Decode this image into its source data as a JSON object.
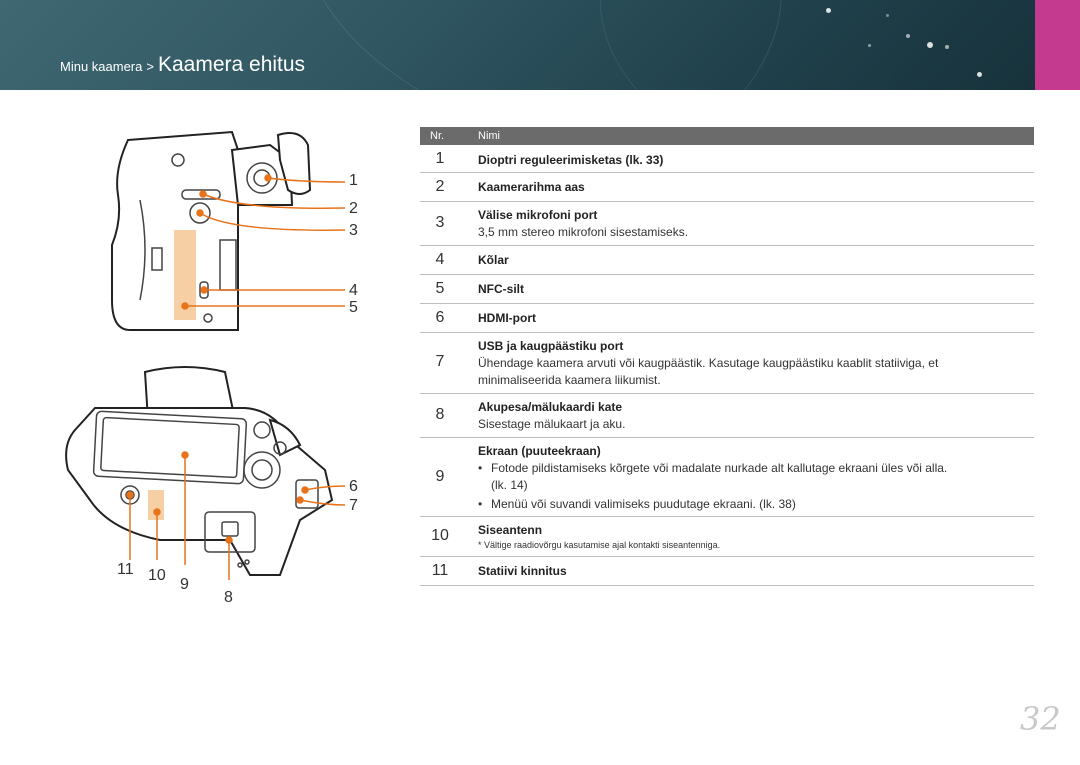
{
  "header": {
    "breadcrumb_parent": "Minu kaamera",
    "breadcrumb_separator": ">",
    "title": "Kaamera ehitus"
  },
  "table": {
    "col_nr": "Nr.",
    "col_name": "Nimi",
    "rows": [
      {
        "nr": "1",
        "name": "Dioptri reguleerimisketas (lk. 33)"
      },
      {
        "nr": "2",
        "name": "Kaamerarihma aas"
      },
      {
        "nr": "3",
        "name": "Välise mikrofoni port",
        "desc": "3,5 mm stereo mikrofoni sisestamiseks."
      },
      {
        "nr": "4",
        "name": "Kõlar"
      },
      {
        "nr": "5",
        "name": "NFC-silt"
      },
      {
        "nr": "6",
        "name": "HDMI-port"
      },
      {
        "nr": "7",
        "name": "USB ja kaugpäästiku port",
        "desc1": "Ühendage kaamera arvuti või kaugpäästik. Kasutage kaugpäästiku kaablit statiiviga, et",
        "desc2": "minimaliseerida kaamera liikumist."
      },
      {
        "nr": "8",
        "name": "Akupesa/mälukaardi kate",
        "desc": "Sisestage mälukaart ja aku."
      },
      {
        "nr": "9",
        "name": "Ekraan (puuteekraan)",
        "bullet1a": "Fotode pildistamiseks kõrgete või madalate nurkade alt kallutage ekraani üles või alla.",
        "bullet1b": "(lk. 14)",
        "bullet2": "Menüü või suvandi valimiseks puudutage ekraani. (lk. 38)"
      },
      {
        "nr": "10",
        "name": "Siseantenn",
        "note": "* Vältige raadiovõrgu kasutamise ajal kontakti siseantenniga."
      },
      {
        "nr": "11",
        "name": "Statiivi kinnitus"
      }
    ]
  },
  "callouts": {
    "c1": "1",
    "c2": "2",
    "c3": "3",
    "c4": "4",
    "c5": "5",
    "c6": "6",
    "c7": "7",
    "c8": "8",
    "c9": "9",
    "c10": "10",
    "c11": "11"
  },
  "bullet_char": "•",
  "page_number": "32",
  "colors": {
    "header": "#2f5560",
    "side_tab": "#c43a8e",
    "table_header": "#6b6b6b",
    "callout_line": "#e8731a",
    "highlight": "#f7cfa4"
  }
}
